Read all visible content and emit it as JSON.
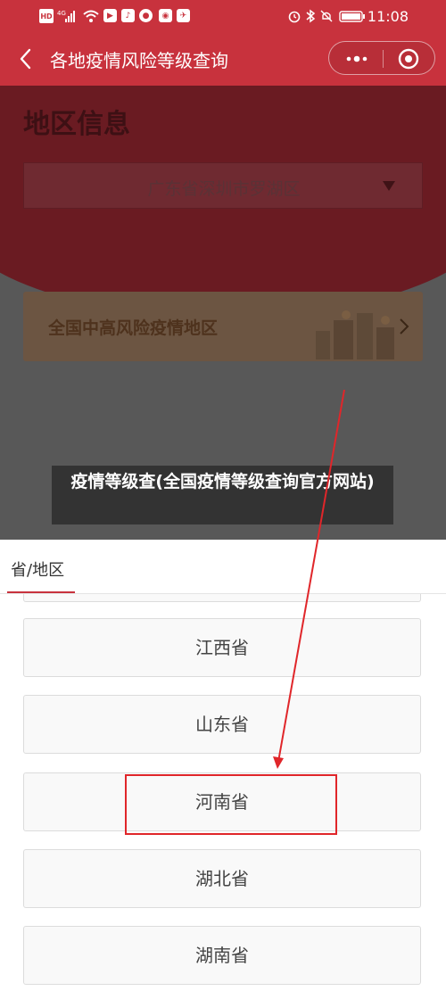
{
  "status_bar": {
    "left_icons": [
      "HD",
      "4G",
      "signal-icon",
      "wifi-icon",
      "app-icons"
    ],
    "time": "11:08",
    "right_icons": [
      "alarm-icon",
      "bluetooth-icon",
      "mute-icon",
      "battery-icon"
    ]
  },
  "nav": {
    "title": "各地疫情风险等级查询",
    "more_icon": "more-icon",
    "close_icon": "target-icon"
  },
  "page": {
    "region_heading": "地区信息",
    "region_select_value": "广东省深圳市罗湖区",
    "risk_card_label": "全国中高风险疫情地区"
  },
  "caption": {
    "text": "疫情等级查(全国疫情等级查询官方网站)"
  },
  "sheet": {
    "tab_label": "省/地区",
    "options": [
      "江西省",
      "山东省",
      "河南省",
      "湖北省",
      "湖南省"
    ],
    "highlighted_option": "河南省"
  },
  "colors": {
    "brand_red": "#c8323d",
    "highlight_red": "#e0262a"
  }
}
